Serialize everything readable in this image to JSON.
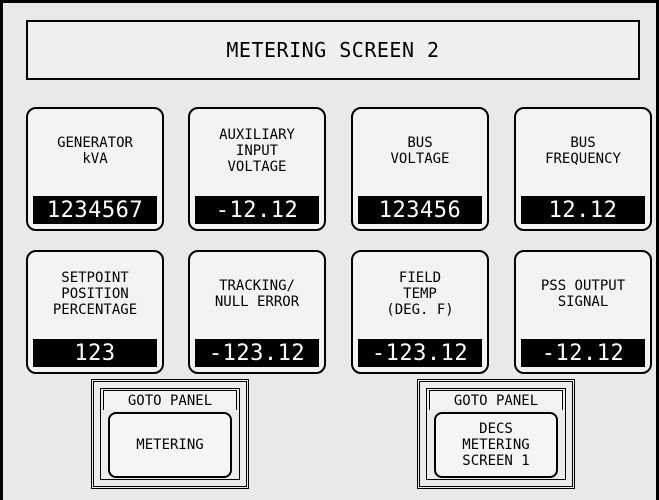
{
  "title": "METERING SCREEN 2",
  "tiles": [
    {
      "label": "GENERATOR\nkVA",
      "value": "1234567"
    },
    {
      "label": "AUXILIARY\nINPUT\nVOLTAGE",
      "value": "-12.12"
    },
    {
      "label": "BUS\nVOLTAGE",
      "value": "123456"
    },
    {
      "label": "BUS\nFREQUENCY",
      "value": "12.12"
    },
    {
      "label": "SETPOINT\nPOSITION\nPERCENTAGE",
      "value": "123"
    },
    {
      "label": "TRACKING/\nNULL ERROR",
      "value": "-123.12"
    },
    {
      "label": "FIELD\nTEMP\n(DEG. F)",
      "value": "-123.12"
    },
    {
      "label": "PSS OUTPUT\nSIGNAL",
      "value": "-12.12"
    }
  ],
  "panel_buttons": [
    {
      "header": "GOTO PANEL",
      "label": "METERING"
    },
    {
      "header": "GOTO PANEL",
      "label": "DECS\nMETERING\nSCREEN 1"
    }
  ]
}
